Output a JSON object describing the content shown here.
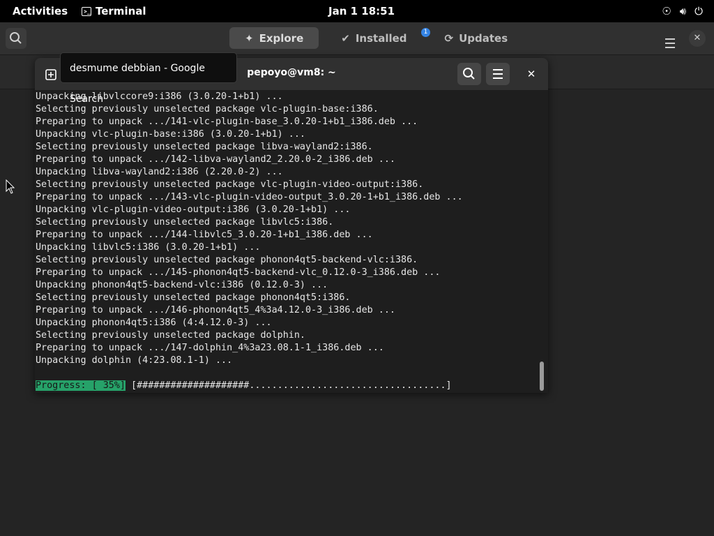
{
  "topbar": {
    "activities": "Activities",
    "app_name": "Terminal",
    "clock": "Jan 1  18:51"
  },
  "software": {
    "tabs": [
      {
        "label": "Explore",
        "icon": "compass-star-icon",
        "active": true
      },
      {
        "label": "Installed",
        "icon": "check-circle-icon",
        "active": false
      },
      {
        "label": "Updates",
        "icon": "refresh-icon",
        "active": false
      }
    ],
    "updates_badge": "1"
  },
  "tooltip": "desmume debbian - Google Search",
  "terminal": {
    "title": "pepoyo@vm8: ~",
    "lines": [
      "Unpacking libvlccore9:i386 (3.0.20-1+b1) ...",
      "Selecting previously unselected package vlc-plugin-base:i386.",
      "Preparing to unpack .../141-vlc-plugin-base_3.0.20-1+b1_i386.deb ...",
      "Unpacking vlc-plugin-base:i386 (3.0.20-1+b1) ...",
      "Selecting previously unselected package libva-wayland2:i386.",
      "Preparing to unpack .../142-libva-wayland2_2.20.0-2_i386.deb ...",
      "Unpacking libva-wayland2:i386 (2.20.0-2) ...",
      "Selecting previously unselected package vlc-plugin-video-output:i386.",
      "Preparing to unpack .../143-vlc-plugin-video-output_3.0.20-1+b1_i386.deb ...",
      "Unpacking vlc-plugin-video-output:i386 (3.0.20-1+b1) ...",
      "Selecting previously unselected package libvlc5:i386.",
      "Preparing to unpack .../144-libvlc5_3.0.20-1+b1_i386.deb ...",
      "Unpacking libvlc5:i386 (3.0.20-1+b1) ...",
      "Selecting previously unselected package phonon4qt5-backend-vlc:i386.",
      "Preparing to unpack .../145-phonon4qt5-backend-vlc_0.12.0-3_i386.deb ...",
      "Unpacking phonon4qt5-backend-vlc:i386 (0.12.0-3) ...",
      "Selecting previously unselected package phonon4qt5:i386.",
      "Preparing to unpack .../146-phonon4qt5_4%3a4.12.0-3_i386.deb ...",
      "Unpacking phonon4qt5:i386 (4:4.12.0-3) ...",
      "Selecting previously unselected package dolphin.",
      "Preparing to unpack .../147-dolphin_4%3a23.08.1-1_i386.deb ...",
      "Unpacking dolphin (4:23.08.1-1) ..."
    ],
    "progress_label": "Progress: [ 35%]",
    "progress_bar": " [####################...................................]",
    "progress_fraction": 0.35
  },
  "colors": {
    "progress_highlight": "#26a269",
    "accent": "#3584e4"
  }
}
